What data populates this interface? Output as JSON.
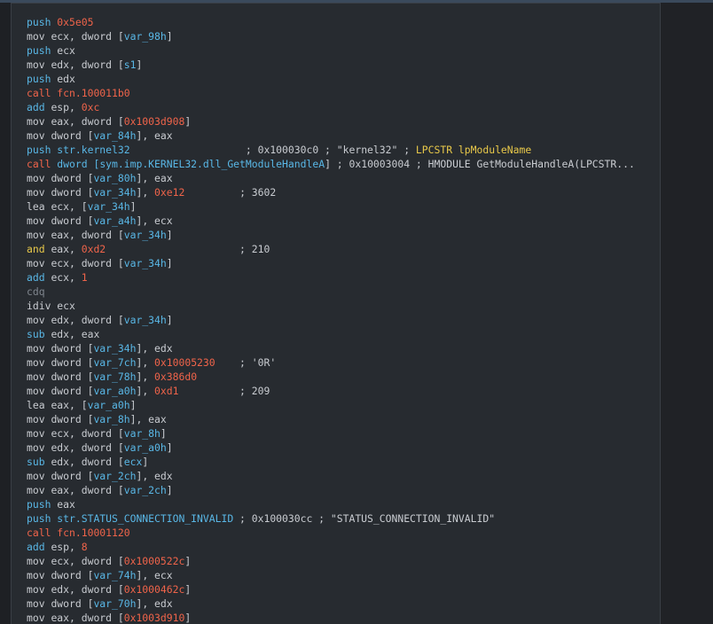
{
  "disassembly": {
    "lines": [
      {
        "mnem": "push",
        "cls": "t-push",
        "ops": [
          {
            "t": "0x5e05",
            "c": "num"
          }
        ]
      },
      {
        "mnem": "mov",
        "cls": "t-mov",
        "ops": [
          {
            "t": "ecx, dword [",
            "c": ""
          },
          {
            "t": "var_98h",
            "c": "flag"
          },
          {
            "t": "]",
            "c": ""
          }
        ]
      },
      {
        "mnem": "push",
        "cls": "t-push",
        "ops": [
          {
            "t": "ecx",
            "c": ""
          }
        ]
      },
      {
        "mnem": "mov",
        "cls": "t-mov",
        "ops": [
          {
            "t": "edx, dword [",
            "c": ""
          },
          {
            "t": "s1",
            "c": "flag"
          },
          {
            "t": "]",
            "c": ""
          }
        ]
      },
      {
        "mnem": "push",
        "cls": "t-push",
        "ops": [
          {
            "t": "edx",
            "c": ""
          }
        ]
      },
      {
        "mnem": "call",
        "cls": "t-call",
        "ops": [
          {
            "t": "fcn.100011b0",
            "c": "num"
          }
        ]
      },
      {
        "mnem": "add",
        "cls": "t-push",
        "ops": [
          {
            "t": "esp, ",
            "c": ""
          },
          {
            "t": "0xc",
            "c": "num"
          }
        ]
      },
      {
        "mnem": "mov",
        "cls": "t-mov",
        "ops": [
          {
            "t": "eax, dword [",
            "c": ""
          },
          {
            "t": "0x1003d908",
            "c": "num"
          },
          {
            "t": "]",
            "c": ""
          }
        ]
      },
      {
        "mnem": "mov",
        "cls": "t-mov",
        "ops": [
          {
            "t": "dword [",
            "c": ""
          },
          {
            "t": "var_84h",
            "c": "flag"
          },
          {
            "t": "], eax",
            "c": ""
          }
        ]
      },
      {
        "mnem": "push",
        "cls": "t-push",
        "ops": [
          {
            "t": "str.kernel32",
            "c": "flag"
          },
          {
            "t": "                   ; 0x100030c0 ; \"kernel32\" ; ",
            "c": ""
          },
          {
            "t": "LPCSTR lpModuleName",
            "c": "str"
          }
        ]
      },
      {
        "mnem": "call",
        "cls": "t-call",
        "ops": [
          {
            "t": "dword [",
            "c": "flag"
          },
          {
            "t": "sym.imp.KERNEL32.dll_GetModuleHandleA",
            "c": "flag"
          },
          {
            "t": "] ; 0x10003004 ; HMODULE GetModuleHandleA(LPCSTR...",
            "c": ""
          }
        ]
      },
      {
        "mnem": "mov",
        "cls": "t-mov",
        "ops": [
          {
            "t": "dword [",
            "c": ""
          },
          {
            "t": "var_80h",
            "c": "flag"
          },
          {
            "t": "], eax",
            "c": ""
          }
        ]
      },
      {
        "mnem": "mov",
        "cls": "t-mov",
        "ops": [
          {
            "t": "dword [",
            "c": ""
          },
          {
            "t": "var_34h",
            "c": "flag"
          },
          {
            "t": "], ",
            "c": ""
          },
          {
            "t": "0xe12",
            "c": "num"
          },
          {
            "t": "         ; 3602",
            "c": ""
          }
        ]
      },
      {
        "mnem": "lea",
        "cls": "t-lea",
        "ops": [
          {
            "t": "ecx, [",
            "c": ""
          },
          {
            "t": "var_34h",
            "c": "flag"
          },
          {
            "t": "]",
            "c": ""
          }
        ]
      },
      {
        "mnem": "mov",
        "cls": "t-mov",
        "ops": [
          {
            "t": "dword [",
            "c": ""
          },
          {
            "t": "var_a4h",
            "c": "flag"
          },
          {
            "t": "], ecx",
            "c": ""
          }
        ]
      },
      {
        "mnem": "mov",
        "cls": "t-mov",
        "ops": [
          {
            "t": "eax, dword [",
            "c": ""
          },
          {
            "t": "var_34h",
            "c": "flag"
          },
          {
            "t": "]",
            "c": ""
          }
        ]
      },
      {
        "mnem": "and",
        "cls": "t-and",
        "ops": [
          {
            "t": "eax, ",
            "c": ""
          },
          {
            "t": "0xd2",
            "c": "num"
          },
          {
            "t": "                      ; 210",
            "c": ""
          }
        ]
      },
      {
        "mnem": "mov",
        "cls": "t-mov",
        "ops": [
          {
            "t": "ecx, dword [",
            "c": ""
          },
          {
            "t": "var_34h",
            "c": "flag"
          },
          {
            "t": "]",
            "c": ""
          }
        ]
      },
      {
        "mnem": "add",
        "cls": "t-push",
        "ops": [
          {
            "t": "ecx, ",
            "c": ""
          },
          {
            "t": "1",
            "c": "num"
          }
        ]
      },
      {
        "mnem": "cdq",
        "cls": "t-cdq",
        "ops": []
      },
      {
        "mnem": "idiv",
        "cls": "t-idiv",
        "ops": [
          {
            "t": "ecx",
            "c": ""
          }
        ]
      },
      {
        "mnem": "mov",
        "cls": "t-mov",
        "ops": [
          {
            "t": "edx, dword [",
            "c": ""
          },
          {
            "t": "var_34h",
            "c": "flag"
          },
          {
            "t": "]",
            "c": ""
          }
        ]
      },
      {
        "mnem": "sub",
        "cls": "t-push",
        "ops": [
          {
            "t": "edx, eax",
            "c": ""
          }
        ]
      },
      {
        "mnem": "mov",
        "cls": "t-mov",
        "ops": [
          {
            "t": "dword [",
            "c": ""
          },
          {
            "t": "var_34h",
            "c": "flag"
          },
          {
            "t": "], edx",
            "c": ""
          }
        ]
      },
      {
        "mnem": "mov",
        "cls": "t-mov",
        "ops": [
          {
            "t": "dword [",
            "c": ""
          },
          {
            "t": "var_7ch",
            "c": "flag"
          },
          {
            "t": "], ",
            "c": ""
          },
          {
            "t": "0x10005230",
            "c": "num"
          },
          {
            "t": "    ; '0R'",
            "c": ""
          }
        ]
      },
      {
        "mnem": "mov",
        "cls": "t-mov",
        "ops": [
          {
            "t": "dword [",
            "c": ""
          },
          {
            "t": "var_78h",
            "c": "flag"
          },
          {
            "t": "], ",
            "c": ""
          },
          {
            "t": "0x386d0",
            "c": "num"
          }
        ]
      },
      {
        "mnem": "mov",
        "cls": "t-mov",
        "ops": [
          {
            "t": "dword [",
            "c": ""
          },
          {
            "t": "var_a0h",
            "c": "flag"
          },
          {
            "t": "], ",
            "c": ""
          },
          {
            "t": "0xd1",
            "c": "num"
          },
          {
            "t": "          ; 209",
            "c": ""
          }
        ]
      },
      {
        "mnem": "lea",
        "cls": "t-lea",
        "ops": [
          {
            "t": "eax, [",
            "c": ""
          },
          {
            "t": "var_a0h",
            "c": "flag"
          },
          {
            "t": "]",
            "c": ""
          }
        ]
      },
      {
        "mnem": "mov",
        "cls": "t-mov",
        "ops": [
          {
            "t": "dword [",
            "c": ""
          },
          {
            "t": "var_8h",
            "c": "flag"
          },
          {
            "t": "], eax",
            "c": ""
          }
        ]
      },
      {
        "mnem": "mov",
        "cls": "t-mov",
        "ops": [
          {
            "t": "ecx, dword [",
            "c": ""
          },
          {
            "t": "var_8h",
            "c": "flag"
          },
          {
            "t": "]",
            "c": ""
          }
        ]
      },
      {
        "mnem": "mov",
        "cls": "t-mov",
        "ops": [
          {
            "t": "edx, dword [",
            "c": ""
          },
          {
            "t": "var_a0h",
            "c": "flag"
          },
          {
            "t": "]",
            "c": ""
          }
        ]
      },
      {
        "mnem": "sub",
        "cls": "t-push",
        "ops": [
          {
            "t": "edx, dword [",
            "c": ""
          },
          {
            "t": "ecx",
            "c": "flag"
          },
          {
            "t": "]",
            "c": ""
          }
        ]
      },
      {
        "mnem": "mov",
        "cls": "t-mov",
        "ops": [
          {
            "t": "dword [",
            "c": ""
          },
          {
            "t": "var_2ch",
            "c": "flag"
          },
          {
            "t": "], edx",
            "c": ""
          }
        ]
      },
      {
        "mnem": "mov",
        "cls": "t-mov",
        "ops": [
          {
            "t": "eax, dword [",
            "c": ""
          },
          {
            "t": "var_2ch",
            "c": "flag"
          },
          {
            "t": "]",
            "c": ""
          }
        ]
      },
      {
        "mnem": "push",
        "cls": "t-push",
        "ops": [
          {
            "t": "eax",
            "c": ""
          }
        ]
      },
      {
        "mnem": "push",
        "cls": "t-push",
        "ops": [
          {
            "t": "str.STATUS_CONNECTION_INVALID",
            "c": "flag"
          },
          {
            "t": " ; 0x100030cc ; \"STATUS_CONNECTION_INVALID\"",
            "c": ""
          }
        ]
      },
      {
        "mnem": "call",
        "cls": "t-call",
        "ops": [
          {
            "t": "fcn.10001120",
            "c": "num"
          }
        ]
      },
      {
        "mnem": "add",
        "cls": "t-push",
        "ops": [
          {
            "t": "esp, ",
            "c": ""
          },
          {
            "t": "8",
            "c": "num"
          }
        ]
      },
      {
        "mnem": "mov",
        "cls": "t-mov",
        "ops": [
          {
            "t": "ecx, dword [",
            "c": ""
          },
          {
            "t": "0x1000522c",
            "c": "num"
          },
          {
            "t": "]",
            "c": ""
          }
        ]
      },
      {
        "mnem": "mov",
        "cls": "t-mov",
        "ops": [
          {
            "t": "dword [",
            "c": ""
          },
          {
            "t": "var_74h",
            "c": "flag"
          },
          {
            "t": "], ecx",
            "c": ""
          }
        ]
      },
      {
        "mnem": "mov",
        "cls": "t-mov",
        "ops": [
          {
            "t": "edx, dword [",
            "c": ""
          },
          {
            "t": "0x1000462c",
            "c": "num"
          },
          {
            "t": "]",
            "c": ""
          }
        ]
      },
      {
        "mnem": "mov",
        "cls": "t-mov",
        "ops": [
          {
            "t": "dword [",
            "c": ""
          },
          {
            "t": "var_70h",
            "c": "flag"
          },
          {
            "t": "], edx",
            "c": ""
          }
        ]
      },
      {
        "mnem": "mov",
        "cls": "t-mov",
        "ops": [
          {
            "t": "eax, dword [",
            "c": ""
          },
          {
            "t": "0x1003d910",
            "c": "num"
          },
          {
            "t": "]",
            "c": ""
          }
        ]
      }
    ]
  }
}
